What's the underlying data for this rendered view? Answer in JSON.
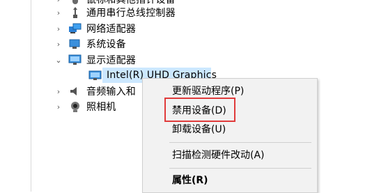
{
  "tree": {
    "items": [
      {
        "label": "通用串行总线控制器",
        "icon": "usb-controller-icon"
      },
      {
        "label": "网络适配器",
        "icon": "network-adapter-icon"
      },
      {
        "label": "系统设备",
        "icon": "system-device-icon"
      },
      {
        "label": "显示适配器",
        "icon": "display-adapter-icon",
        "expanded": true
      },
      {
        "label": "Intel(R) UHD Graphics",
        "icon": "gpu-icon"
      },
      {
        "label": "音频输入和",
        "icon": "audio-icon"
      },
      {
        "label": "照相机",
        "icon": "camera-icon"
      }
    ],
    "top_partial_label": "鼠标和其他指针设备"
  },
  "context_menu": {
    "items": [
      {
        "label": "更新驱动程序(P)"
      },
      {
        "label": "禁用设备(D)",
        "highlighted": true
      },
      {
        "label": "卸载设备(U)"
      },
      {
        "label": "扫描检测硬件改动(A)"
      },
      {
        "label": "属性(R)",
        "bold": true
      }
    ]
  },
  "colors": {
    "selection": "#cce8ff",
    "highlight_box": "#e03a3a",
    "menu_bg": "#f2f2f2"
  }
}
